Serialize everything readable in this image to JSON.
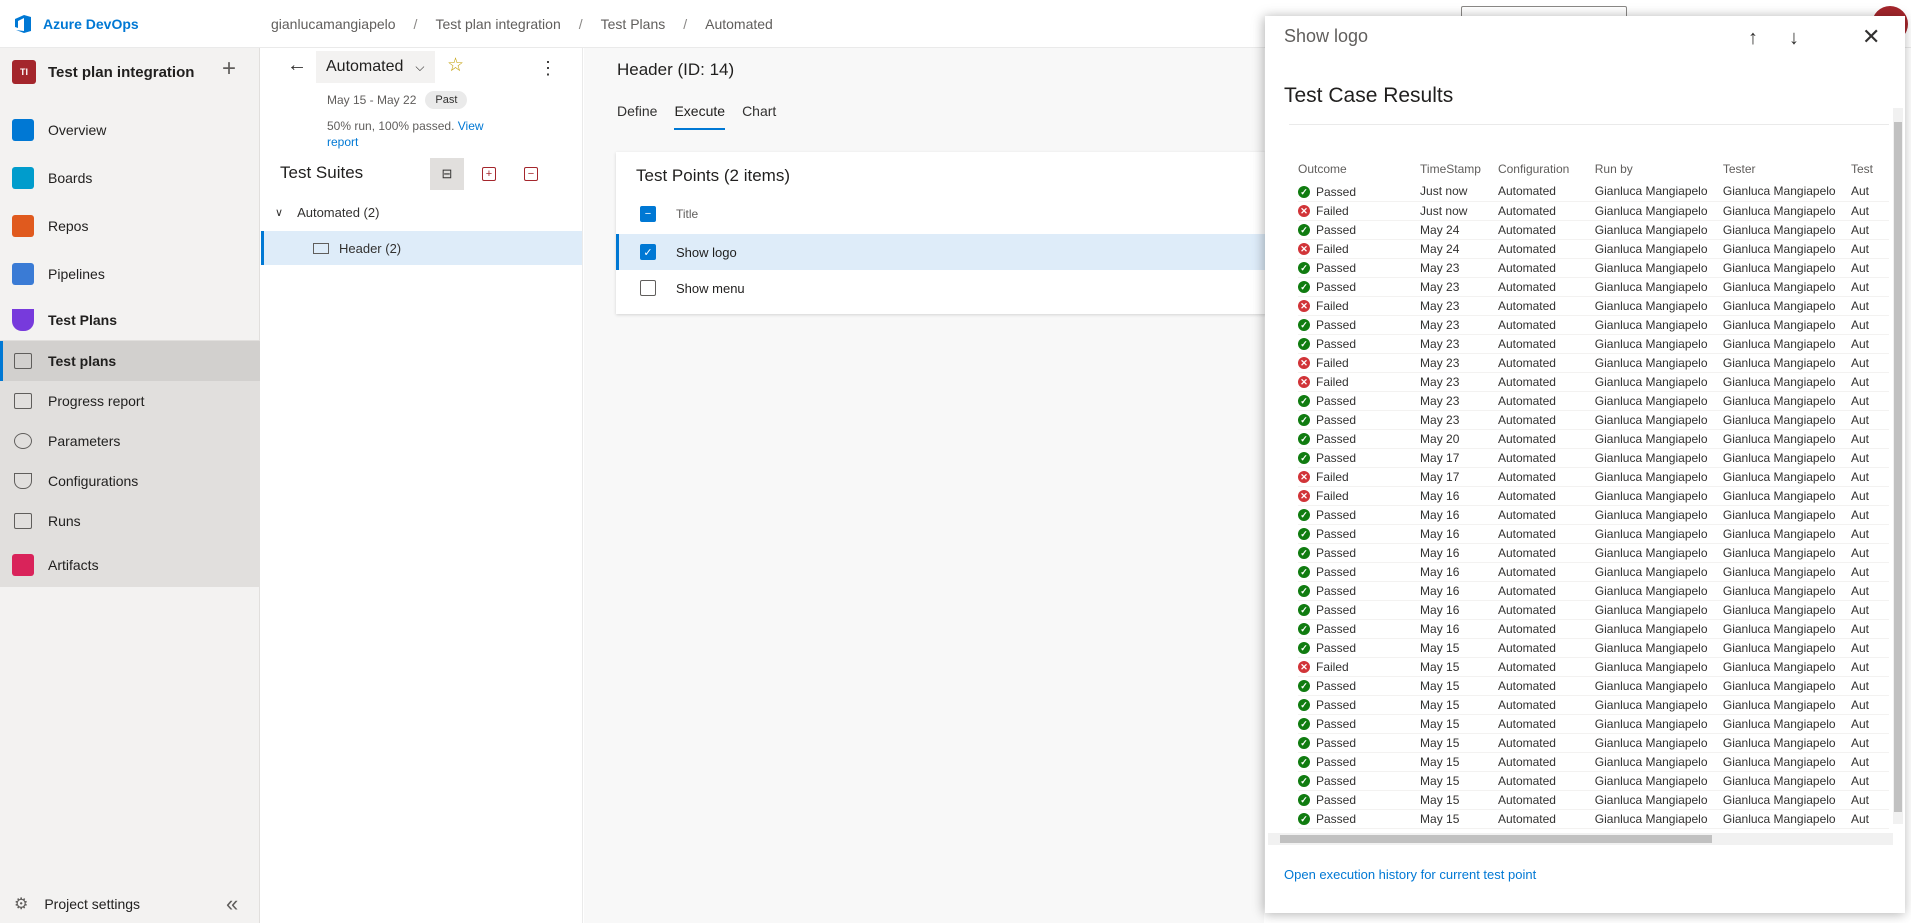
{
  "topbar": {
    "app_name": "Azure DevOps",
    "breadcrumb": [
      "gianlucamangiapelo",
      "Test plan integration",
      "Test Plans",
      "Automated"
    ]
  },
  "sidebar": {
    "project_badge": "TI",
    "project_name": "Test plan integration",
    "items": [
      {
        "label": "Overview",
        "icon": "overview-icon",
        "color": "#0078d4"
      },
      {
        "label": "Boards",
        "icon": "boards-icon",
        "color": "#009ccc"
      },
      {
        "label": "Repos",
        "icon": "repos-icon",
        "color": "#e05a1e"
      },
      {
        "label": "Pipelines",
        "icon": "pipelines-icon",
        "color": "#3a7bd5"
      },
      {
        "label": "Test Plans",
        "icon": "test-plans-icon",
        "color": "#773adc"
      }
    ],
    "sub_items": [
      "Test plans",
      "Progress report",
      "Parameters",
      "Configurations",
      "Runs"
    ],
    "artifacts_label": "Artifacts",
    "project_settings": "Project settings"
  },
  "plan": {
    "name": "Automated",
    "dates": "May 15 - May 22",
    "past_badge": "Past",
    "run_info": "50% run, 100% passed.",
    "view_report": "View report",
    "suites_title": "Test Suites",
    "suites": [
      {
        "label": "Automated (2)"
      },
      {
        "label": "Header (2)"
      }
    ]
  },
  "main": {
    "header_title": "Header (ID: 14)",
    "tabs": [
      "Define",
      "Execute",
      "Chart"
    ],
    "points_title": "Test Points (2 items)",
    "column_title": "Title",
    "points": [
      "Show logo",
      "Show menu"
    ]
  },
  "panel": {
    "heading": "Show logo",
    "title": "Test Case Results",
    "columns": [
      "Outcome",
      "TimeStamp",
      "Configuration",
      "Run by",
      "Tester",
      "Test"
    ],
    "rows": [
      [
        "Passed",
        "Just now"
      ],
      [
        "Failed",
        "Just now"
      ],
      [
        "Passed",
        "May 24"
      ],
      [
        "Failed",
        "May 24"
      ],
      [
        "Passed",
        "May 23"
      ],
      [
        "Passed",
        "May 23"
      ],
      [
        "Failed",
        "May 23"
      ],
      [
        "Passed",
        "May 23"
      ],
      [
        "Passed",
        "May 23"
      ],
      [
        "Failed",
        "May 23"
      ],
      [
        "Failed",
        "May 23"
      ],
      [
        "Passed",
        "May 23"
      ],
      [
        "Passed",
        "May 23"
      ],
      [
        "Passed",
        "May 20"
      ],
      [
        "Passed",
        "May 17"
      ],
      [
        "Failed",
        "May 17"
      ],
      [
        "Failed",
        "May 16"
      ],
      [
        "Passed",
        "May 16"
      ],
      [
        "Passed",
        "May 16"
      ],
      [
        "Passed",
        "May 16"
      ],
      [
        "Passed",
        "May 16"
      ],
      [
        "Passed",
        "May 16"
      ],
      [
        "Passed",
        "May 16"
      ],
      [
        "Passed",
        "May 16"
      ],
      [
        "Passed",
        "May 15"
      ],
      [
        "Failed",
        "May 15"
      ],
      [
        "Passed",
        "May 15"
      ],
      [
        "Passed",
        "May 15"
      ],
      [
        "Passed",
        "May 15"
      ],
      [
        "Passed",
        "May 15"
      ],
      [
        "Passed",
        "May 15"
      ],
      [
        "Passed",
        "May 15"
      ],
      [
        "Passed",
        "May 15"
      ],
      [
        "Passed",
        "May 15"
      ]
    ],
    "configuration": "Automated",
    "run_by": "Gianluca Mangiapelo",
    "tester": "Gianluca Mangiapelo",
    "last_col": "Aut",
    "link": "Open execution history for current test point"
  }
}
